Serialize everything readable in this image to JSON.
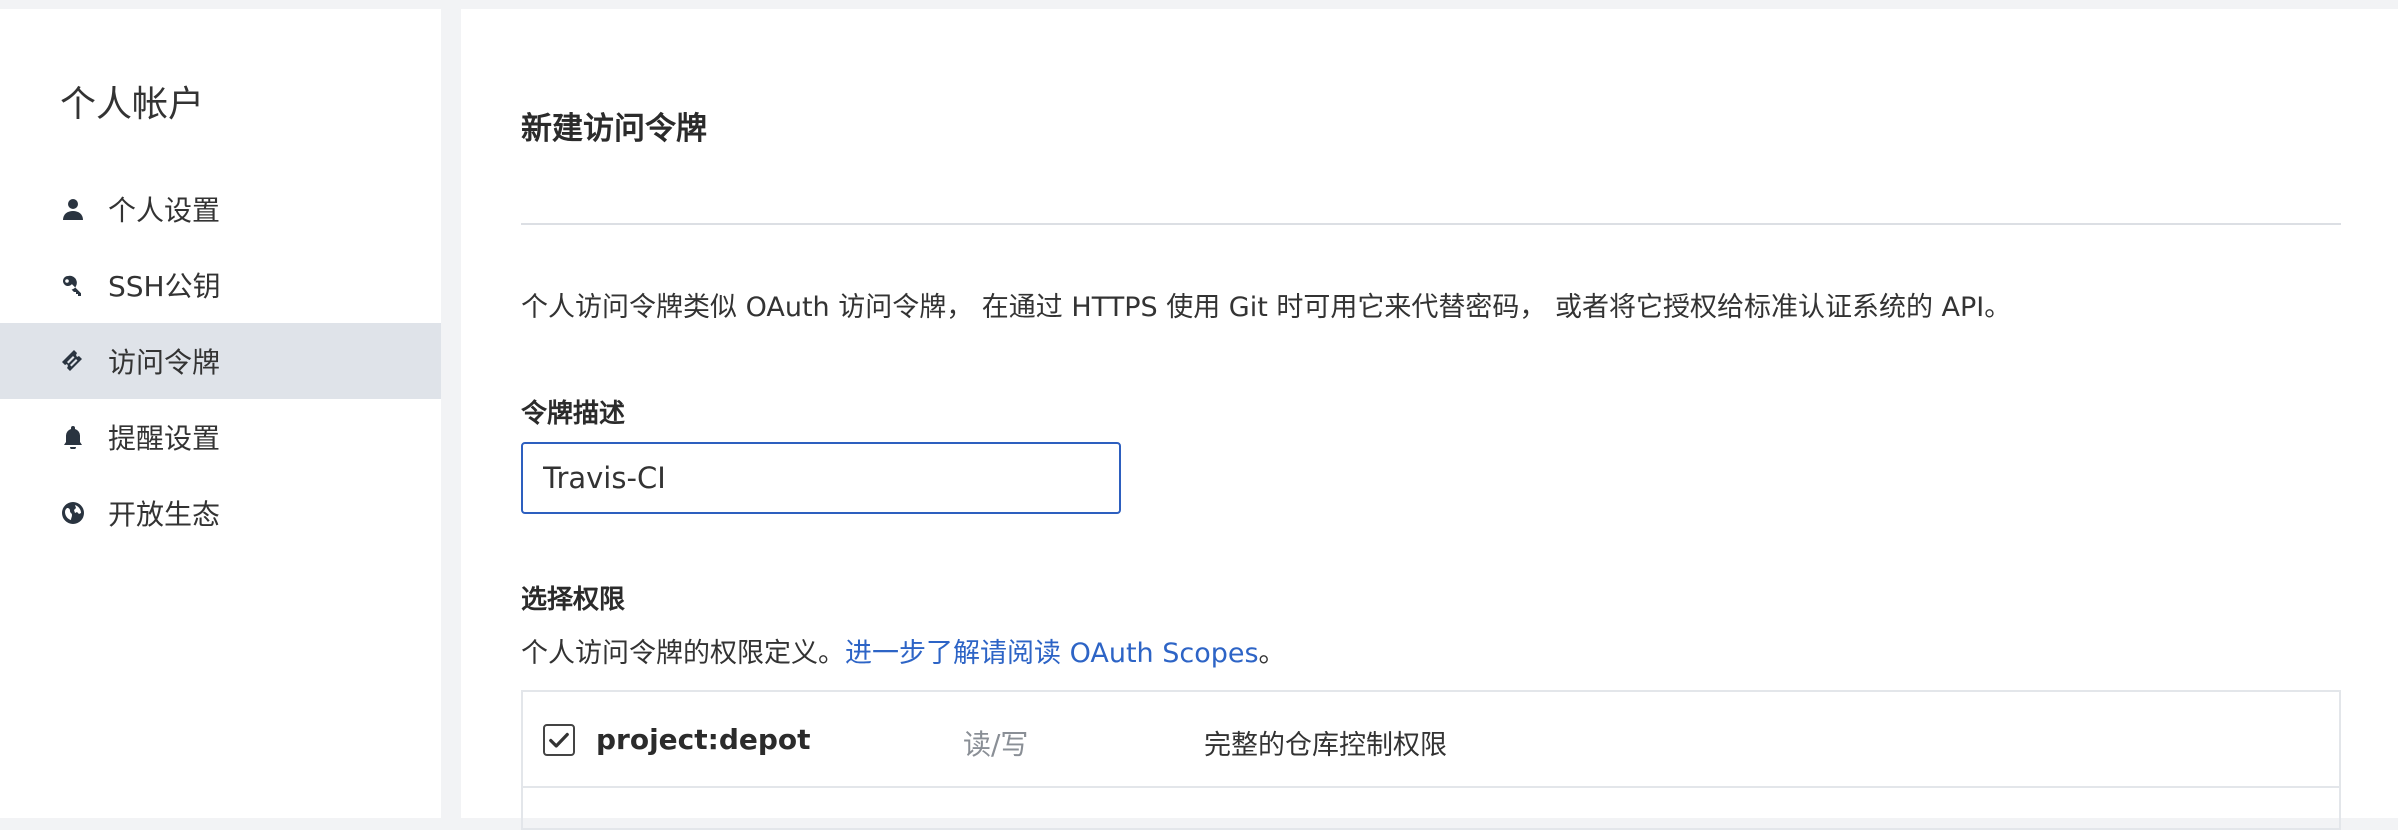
{
  "sidebar": {
    "title": "个人帐户",
    "items": [
      {
        "label": "个人设置",
        "icon": "user-icon"
      },
      {
        "label": "SSH公钥",
        "icon": "key-icon"
      },
      {
        "label": "访问令牌",
        "icon": "ticket-icon",
        "active": true
      },
      {
        "label": "提醒设置",
        "icon": "bell-icon"
      },
      {
        "label": "开放生态",
        "icon": "globe-icon"
      }
    ]
  },
  "main": {
    "title": "新建访问令牌",
    "description": "个人访问令牌类似 OAuth 访问令牌， 在通过 HTTPS 使用 Git 时可用它来代替密码， 或者将它授权给标准认证系统的 API。",
    "token_label": "令牌描述",
    "token_value": "Travis-CI",
    "scope_heading": "选择权限",
    "scope_desc_prefix": "个人访问令牌的权限定义。",
    "scope_desc_link": "进一步了解请阅读 OAuth Scopes",
    "scope_desc_suffix": "。",
    "scopes": [
      {
        "name": "project:depot",
        "access": "读/写",
        "detail": "完整的仓库控制权限",
        "checked": true
      }
    ]
  },
  "colors": {
    "accent": "#2d5fbf",
    "link": "#2d64c6",
    "active_nav": "#dfe3e9",
    "background": "#f2f3f5"
  }
}
